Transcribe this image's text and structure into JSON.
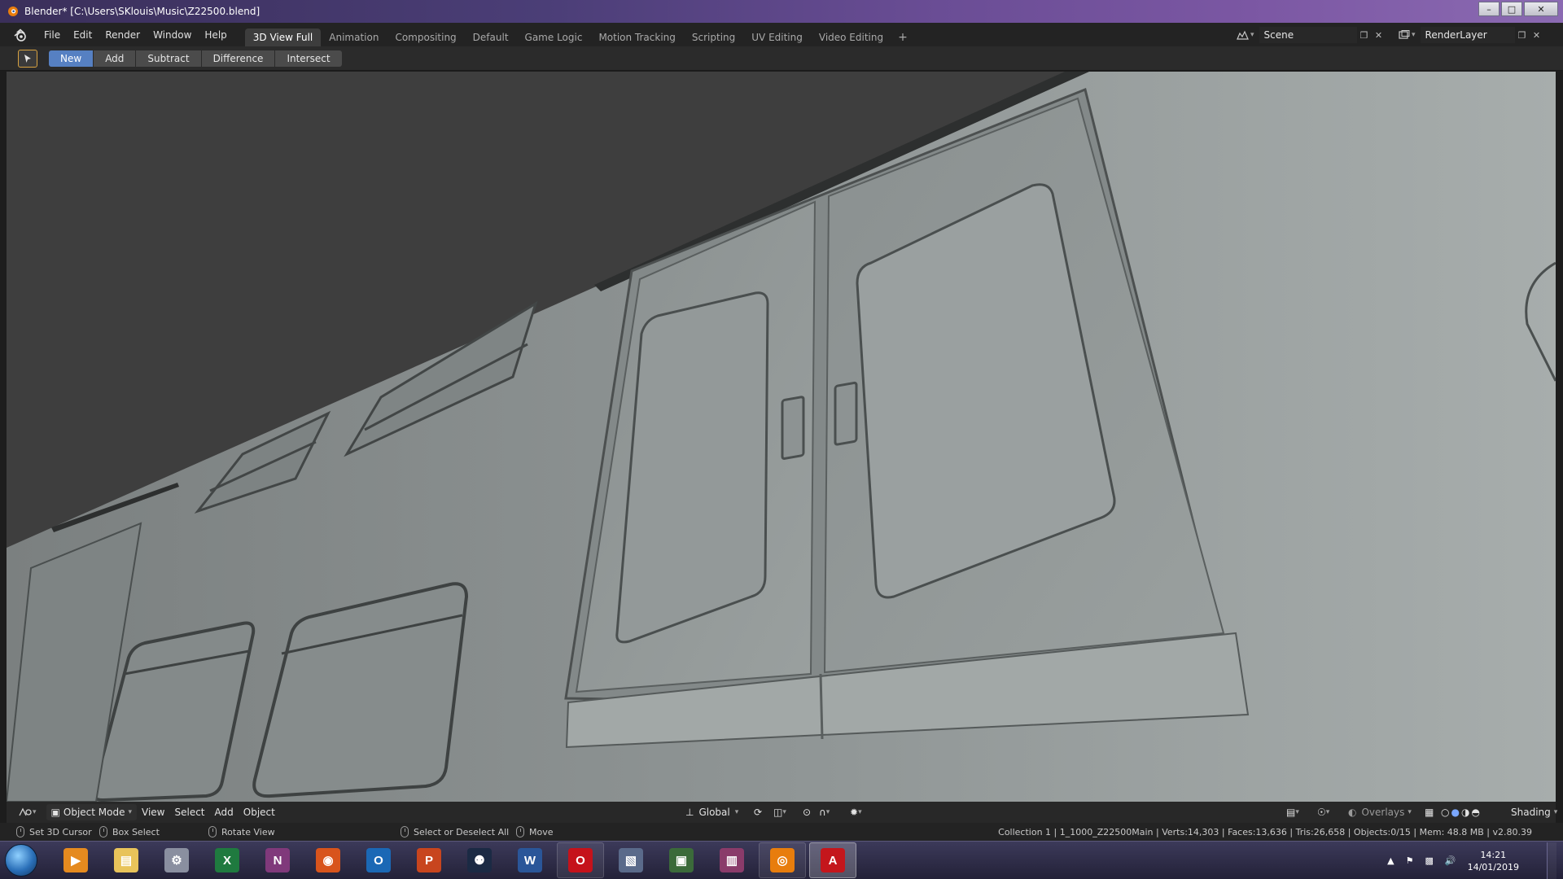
{
  "window": {
    "title": "Blender* [C:\\Users\\SKlouis\\Music\\Z22500.blend]",
    "controls": {
      "minimize": "–",
      "maximize": "□",
      "close": "✕"
    }
  },
  "menubar": {
    "items": [
      "File",
      "Edit",
      "Render",
      "Window",
      "Help"
    ]
  },
  "workspaces": {
    "tabs": [
      "3D View Full",
      "Animation",
      "Compositing",
      "Default",
      "Game Logic",
      "Motion Tracking",
      "Scripting",
      "UV Editing",
      "Video Editing"
    ],
    "active_index": 0,
    "add_label": "+"
  },
  "scene": {
    "name": "Scene"
  },
  "render_layer": {
    "name": "RenderLayer"
  },
  "tool_header": {
    "modes": [
      "New",
      "Add",
      "Subtract",
      "Difference",
      "Intersect"
    ],
    "active_index": 0
  },
  "viewport_header": {
    "object_mode": "Object Mode",
    "menus": [
      "View",
      "Select",
      "Add",
      "Object"
    ],
    "transform_orientation": "Global",
    "overlays_label": "Overlays",
    "shading_label": "Shading"
  },
  "statusbar": {
    "hints": [
      "Set 3D Cursor",
      "Box Select",
      "Rotate View",
      "Select or Deselect All",
      "Move"
    ],
    "stats": "Collection 1 | 1_1000_Z22500Main | Verts:14,303 | Faces:13,636 | Tris:26,658 | Objects:0/15 | Mem: 48.8 MB | v2.80.39"
  },
  "taskbar": {
    "apps": [
      {
        "name": "media-player",
        "glyph": "▶",
        "color": "#e58a1f"
      },
      {
        "name": "file-explorer",
        "glyph": "▤",
        "color": "#e8c35a"
      },
      {
        "name": "settings",
        "glyph": "⚙",
        "color": "#8a8fa0"
      },
      {
        "name": "excel",
        "glyph": "X",
        "color": "#1f7a3f"
      },
      {
        "name": "onenote",
        "glyph": "N",
        "color": "#80397b"
      },
      {
        "name": "web-app",
        "glyph": "◉",
        "color": "#d8541c"
      },
      {
        "name": "outlook",
        "glyph": "O",
        "color": "#1b68b5"
      },
      {
        "name": "powerpoint",
        "glyph": "P",
        "color": "#c8451e"
      },
      {
        "name": "steam",
        "glyph": "⚉",
        "color": "#1b2a44"
      },
      {
        "name": "word",
        "glyph": "W",
        "color": "#2a5699"
      },
      {
        "name": "opera",
        "glyph": "O",
        "color": "#c5121b"
      },
      {
        "name": "image-editor",
        "glyph": "▧",
        "color": "#5a6a8a"
      },
      {
        "name": "system-monitor",
        "glyph": "▣",
        "color": "#3b6a3a"
      },
      {
        "name": "winrar",
        "glyph": "▥",
        "color": "#8a3b6a"
      },
      {
        "name": "blender",
        "glyph": "◎",
        "color": "#e87d0d"
      },
      {
        "name": "autodesk",
        "glyph": "A",
        "color": "#c4161c"
      }
    ],
    "clock_time": "14:21",
    "clock_date": "14/01/2019"
  }
}
